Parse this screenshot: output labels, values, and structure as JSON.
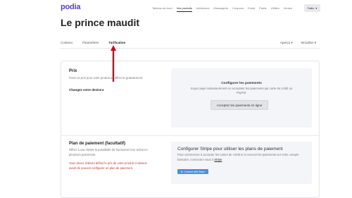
{
  "app": {
    "logo": "podia"
  },
  "topnav": {
    "items": [
      "Tableau de bord",
      "Vos produits",
      "Adhésions",
      "Messagerie",
      "Coupons",
      "Email",
      "Public",
      "Affiliés",
      "Ventes"
    ],
    "active_index": 1,
    "user_label": "Gabo",
    "user_chevron": "▾"
  },
  "page": {
    "title": "Le prince maudit"
  },
  "tabs": {
    "items": [
      "Contenu",
      "Paramètres",
      "Tarification"
    ],
    "active_index": 2,
    "right_items": [
      "Aperçu ▾",
      "Brouillon ▾"
    ]
  },
  "pricing": {
    "title": "Prix",
    "description": "Fixez un prix pour votre produit ou offrez-le gratuitement.",
    "change_currency": "Changez votre devise",
    "change_currency_arrow": "▸",
    "panel_title": "Configurer les paiements",
    "panel_text": "Soyez payé instantanément en acceptant les paiements par carte de crédit ou PayPal.",
    "panel_button": "Acceptez les paiements en ligne"
  },
  "payment_plan": {
    "title": "Plan de paiement (facultatif)",
    "description": "Offrez à vos clients la possibilité de fractionner leur achat en plusieurs paiements.",
    "warning": "Vous devez d'abord définir le prix de votre produit ci-dessus avant de pouvoir configurer un plan de paiement.",
    "panel_title": "Configurer Stripe pour utiliser les plans de paiement",
    "panel_text": "Pour commencer à accepter les cartes de crédit et à recevoir les paiements sur votre compte bancaire, connectez-vous à",
    "panel_link": "Stripe",
    "panel_text_end": ".",
    "stripe_button": "Connect with Stripe",
    "stripe_icon_glyph": "S"
  },
  "colors": {
    "brand": "#5a3cc8",
    "arrow": "#d0021b",
    "stripe": "#4a90e2",
    "warning": "#c0392b"
  }
}
